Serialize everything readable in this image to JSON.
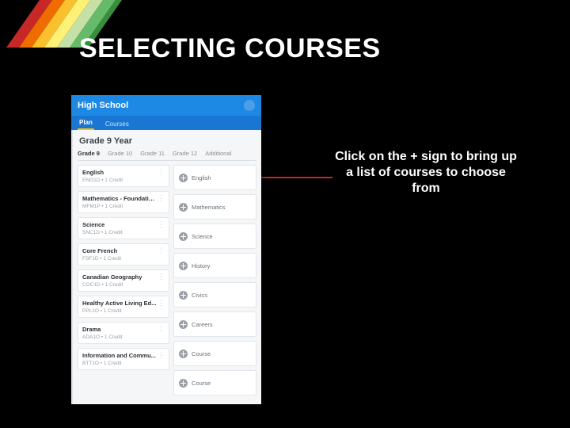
{
  "slide": {
    "title": "SELECTING COURSES",
    "callout": "Click on the + sign to bring up a list of courses to choose from"
  },
  "app": {
    "header_title": "High School",
    "nav": {
      "tabs": [
        "Plan",
        "Courses"
      ],
      "active_index": 0
    },
    "year_title": "Grade 9 Year",
    "year_tabs": [
      "Grade 9",
      "Grade 10",
      "Grade 11",
      "Grade 12",
      "Additional"
    ],
    "year_active_index": 0,
    "left_note": "",
    "left_cards": [
      {
        "name": "English",
        "sub": "ENG1D • 1 Credit"
      },
      {
        "name": "Mathematics - Foundations",
        "sub": "MFM1P • 1 Credit"
      },
      {
        "name": "Science",
        "sub": "SNC1D • 1 Credit"
      },
      {
        "name": "Core French",
        "sub": "FSF1D • 1 Credit"
      },
      {
        "name": "Canadian Geography",
        "sub": "CGC1D • 1 Credit"
      },
      {
        "name": "Healthy Active Living Ed...",
        "sub": "PPL1O • 1 Credit"
      },
      {
        "name": "Drama",
        "sub": "ADA1O • 1 Credit"
      },
      {
        "name": "Information and Commu...",
        "sub": "BTT1O • 1 Credit"
      }
    ],
    "right_slots": [
      {
        "label": "English"
      },
      {
        "label": "Mathematics"
      },
      {
        "label": "Science"
      },
      {
        "label": "History"
      },
      {
        "label": "Civics"
      },
      {
        "label": "Careers"
      },
      {
        "label": "Course"
      },
      {
        "label": "Course"
      }
    ]
  }
}
